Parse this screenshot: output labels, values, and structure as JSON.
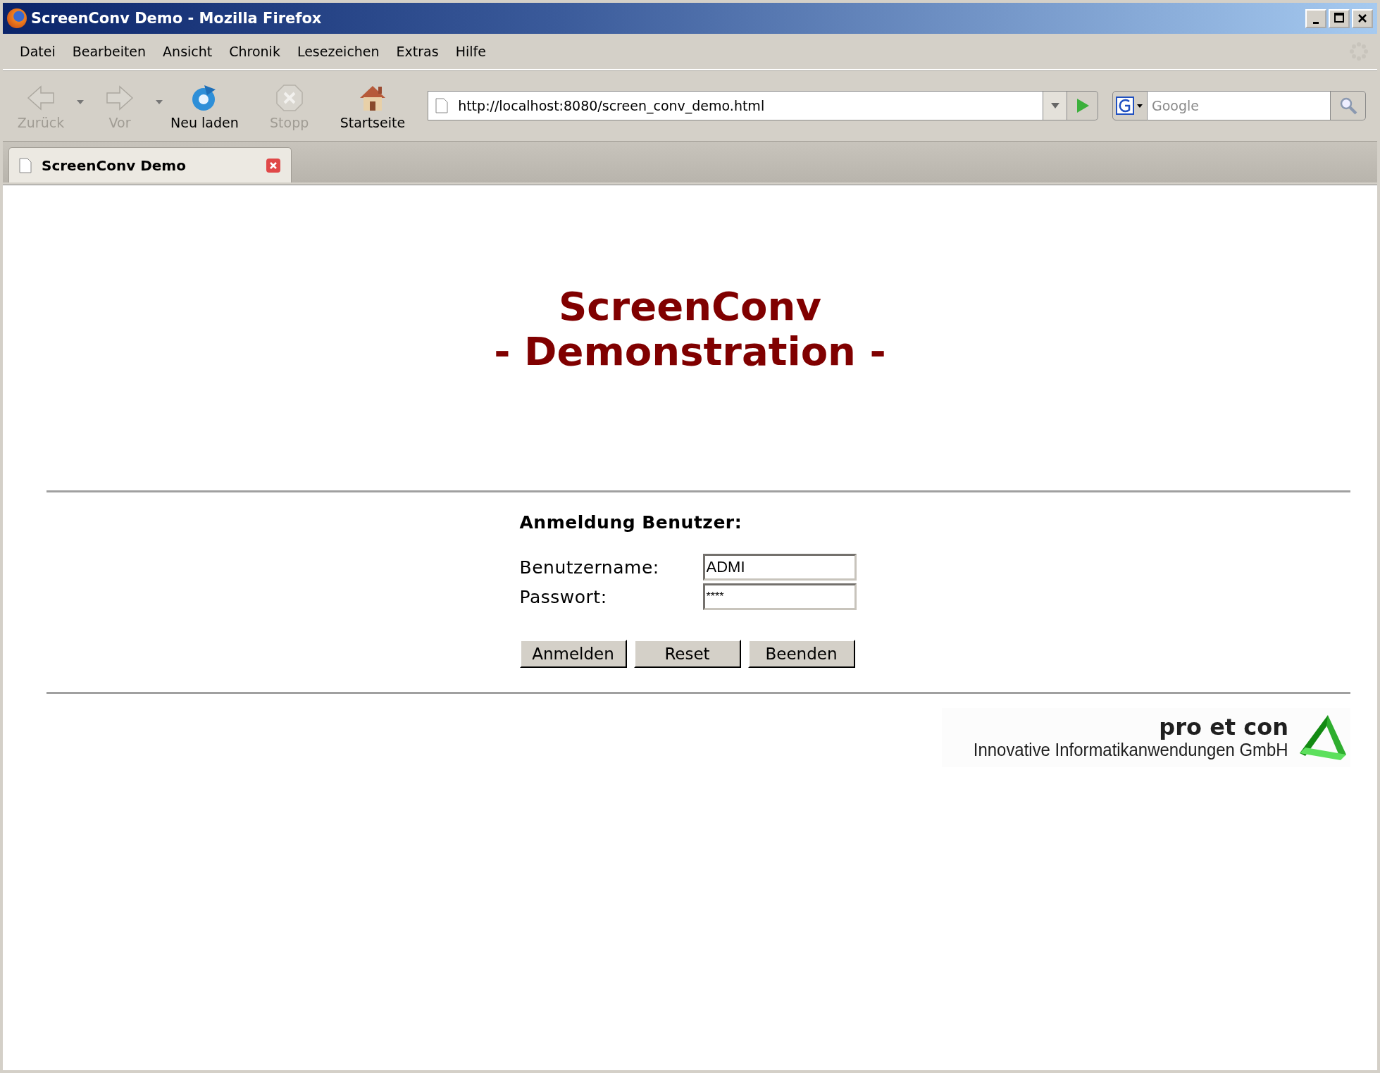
{
  "window": {
    "title": "ScreenConv Demo - Mozilla Firefox"
  },
  "menu": [
    "Datei",
    "Bearbeiten",
    "Ansicht",
    "Chronik",
    "Lesezeichen",
    "Extras",
    "Hilfe"
  ],
  "toolbar": [
    {
      "kind": "back",
      "label": "Zurück",
      "disabled": true,
      "has_menu": true
    },
    {
      "kind": "forward",
      "label": "Vor",
      "disabled": true,
      "has_menu": true
    },
    {
      "kind": "reload",
      "label": "Neu laden",
      "disabled": false,
      "has_menu": false
    },
    {
      "kind": "stop",
      "label": "Stopp",
      "disabled": true,
      "has_menu": false
    },
    {
      "kind": "home",
      "label": "Startseite",
      "disabled": false,
      "has_menu": false
    }
  ],
  "address_bar": {
    "value": "http://localhost:8080/screen_conv_demo.html"
  },
  "search": {
    "placeholder": "Google"
  },
  "tabs": [
    {
      "label": "ScreenConv Demo",
      "selected": true
    }
  ],
  "page": {
    "title": "ScreenConv",
    "subtitle": "- Demonstration -",
    "login": {
      "heading": "Anmeldung Benutzer:",
      "fields": [
        {
          "label": "Benutzername:",
          "value": "ADMI",
          "kind": "text"
        },
        {
          "label": "Passwort:",
          "value": "****",
          "kind": "password"
        }
      ],
      "buttons": [
        "Anmelden",
        "Reset",
        "Beenden"
      ]
    },
    "footer": {
      "brand": "pro et con",
      "tagline": "Innovative Informatikanwendungen GmbH"
    }
  }
}
